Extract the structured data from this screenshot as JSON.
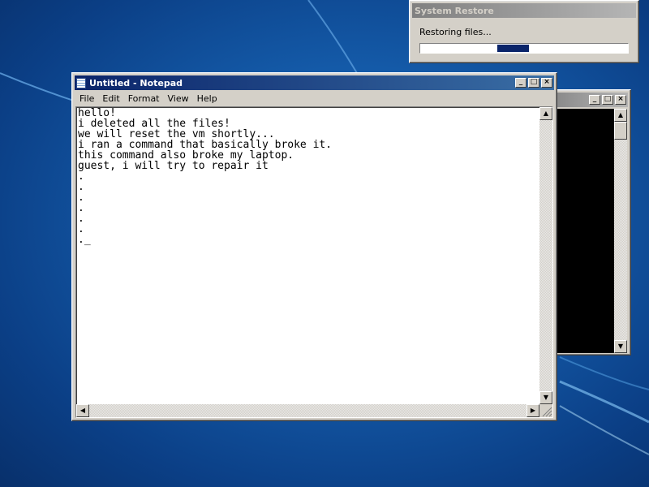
{
  "system_restore": {
    "title": "System Restore",
    "status": "Restoring files...",
    "progress_fraction": 0.5
  },
  "notepad": {
    "title": "Untitled - Notepad",
    "menu": [
      "File",
      "Edit",
      "Format",
      "View",
      "Help"
    ],
    "content": "hello!\ni deleted all the files!\nwe will reset the vm shortly...\ni ran a command that basically broke it.\nthis command also broke my laptop.\nguest, i will try to repair it\n.\n.\n.\n.\n.\n.\n._"
  },
  "console": {
    "title": ""
  },
  "icons": {
    "minimize": "minimize-icon",
    "maximize": "maximize-icon",
    "close": "close-icon",
    "scroll_up": "scroll-up-arrow-icon",
    "scroll_down": "scroll-down-arrow-icon",
    "scroll_left": "scroll-left-arrow-icon",
    "scroll_right": "scroll-right-arrow-icon"
  },
  "colors": {
    "desktop": "#145aa8",
    "active_title": "#0a246a",
    "inactive_title": "#808080",
    "progress": "#0a246a",
    "console_bg": "#000000"
  }
}
